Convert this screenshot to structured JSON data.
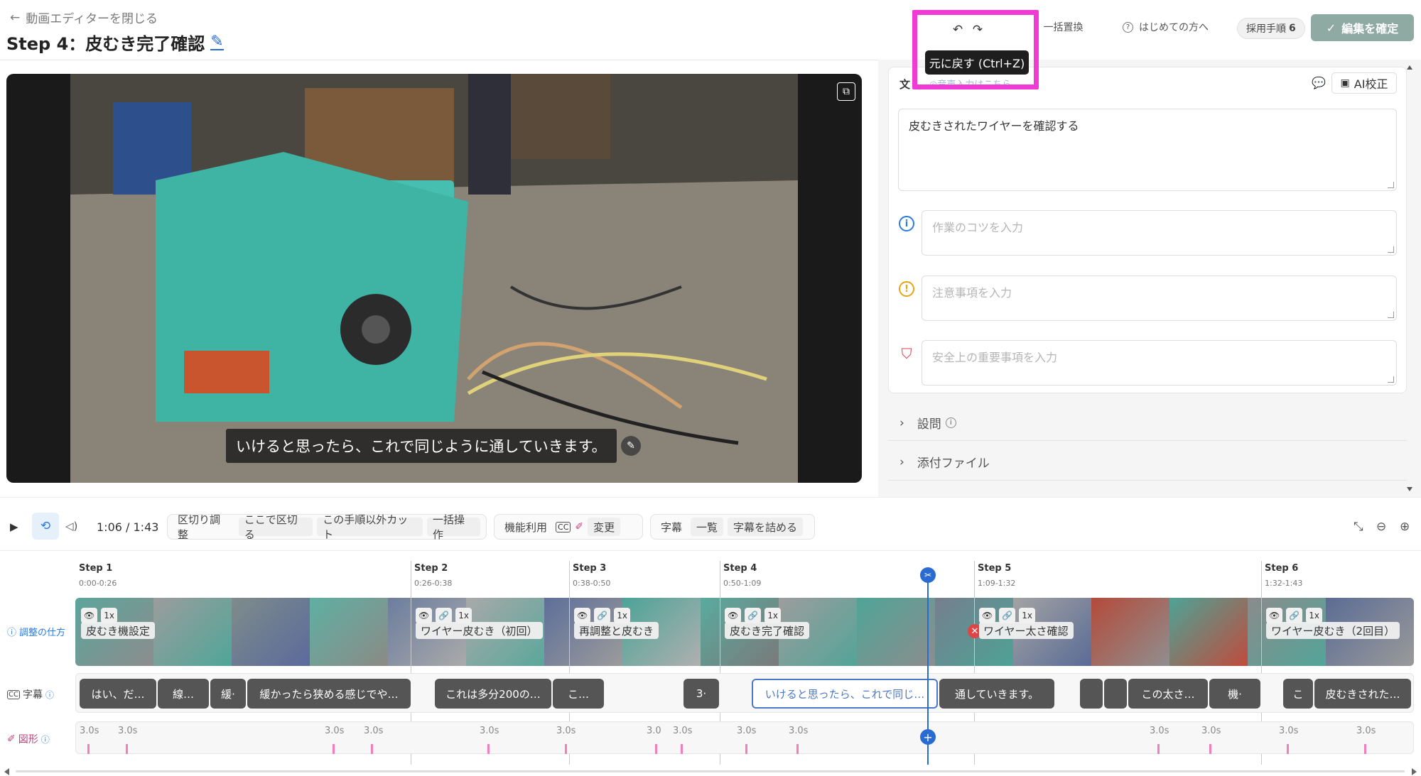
{
  "header": {
    "back_label": "動画エディターを閉じる",
    "title": "Step 4：皮むき完了確認",
    "bulk_replace": "一括置換",
    "first_time": "はじめての方へ",
    "adopted_steps_label": "採用手順",
    "adopted_steps_count": "6",
    "confirm_label": "編集を確定"
  },
  "tooltip": {
    "text": "元に戻す (Ctrl+Z)"
  },
  "video": {
    "caption": "いけると思ったら、これで同じように通していきます。"
  },
  "panel": {
    "section_label": "文",
    "section_sub": "◎音声入力はこちら",
    "ai_button": "AI校正",
    "main_text": "皮むきされたワイヤーを確認する",
    "tips_placeholder": "作業のコツを入力",
    "caution_placeholder": "注意事項を入力",
    "safety_placeholder": "安全上の重要事項を入力",
    "accordion": [
      "設問",
      "添付ファイル"
    ]
  },
  "toolbar": {
    "time": "1:06 / 1:43",
    "group1": [
      "区切り調整",
      "ここで区切る",
      "この手順以外カット",
      "一括操作"
    ],
    "group2_label": "機能利用",
    "group2_button": "変更",
    "group3_label": "字幕",
    "group3_buttons": [
      "一覧",
      "字幕を詰める"
    ]
  },
  "timeline": {
    "steps": [
      {
        "name": "Step 1",
        "range": "0:00-0:26",
        "clip": "皮むき機設定",
        "speed": "1x"
      },
      {
        "name": "Step 2",
        "range": "0:26-0:38",
        "clip": "ワイヤー皮むき（初回）",
        "speed": "1x"
      },
      {
        "name": "Step 3",
        "range": "0:38-0:50",
        "clip": "再調整と皮むき",
        "speed": "1x"
      },
      {
        "name": "Step 4",
        "range": "0:50-1:09",
        "clip": "皮むき完了確認",
        "speed": "1x"
      },
      {
        "name": "Step 5",
        "range": "1:09-1:32",
        "clip": "ワイヤー太さ確認",
        "speed": "1x"
      },
      {
        "name": "Step 6",
        "range": "1:32-1:43",
        "clip": "ワイヤー皮むき（2回目）",
        "speed": "1x"
      }
    ],
    "row_labels": {
      "adjust": "調整の仕方",
      "subtitles": "字幕",
      "shapes": "図形"
    },
    "subtitles": [
      "はい、だ…",
      "線…",
      "緩·",
      "緩かったら狭める感じでや…",
      "これは多分200の…",
      "こ…",
      "3·",
      "いけると思ったら、これで同じ…",
      "通していきます。",
      "この太さ…",
      "機·",
      "こ",
      "皮むきされた…"
    ],
    "marker_label": "3.0s",
    "marker_label_short": "3.0"
  },
  "colors": {
    "accent": "#2a6bd1",
    "highlight": "#f03ad4",
    "confirm_bg": "#8fa9a3",
    "marker": "#f27fb6"
  }
}
